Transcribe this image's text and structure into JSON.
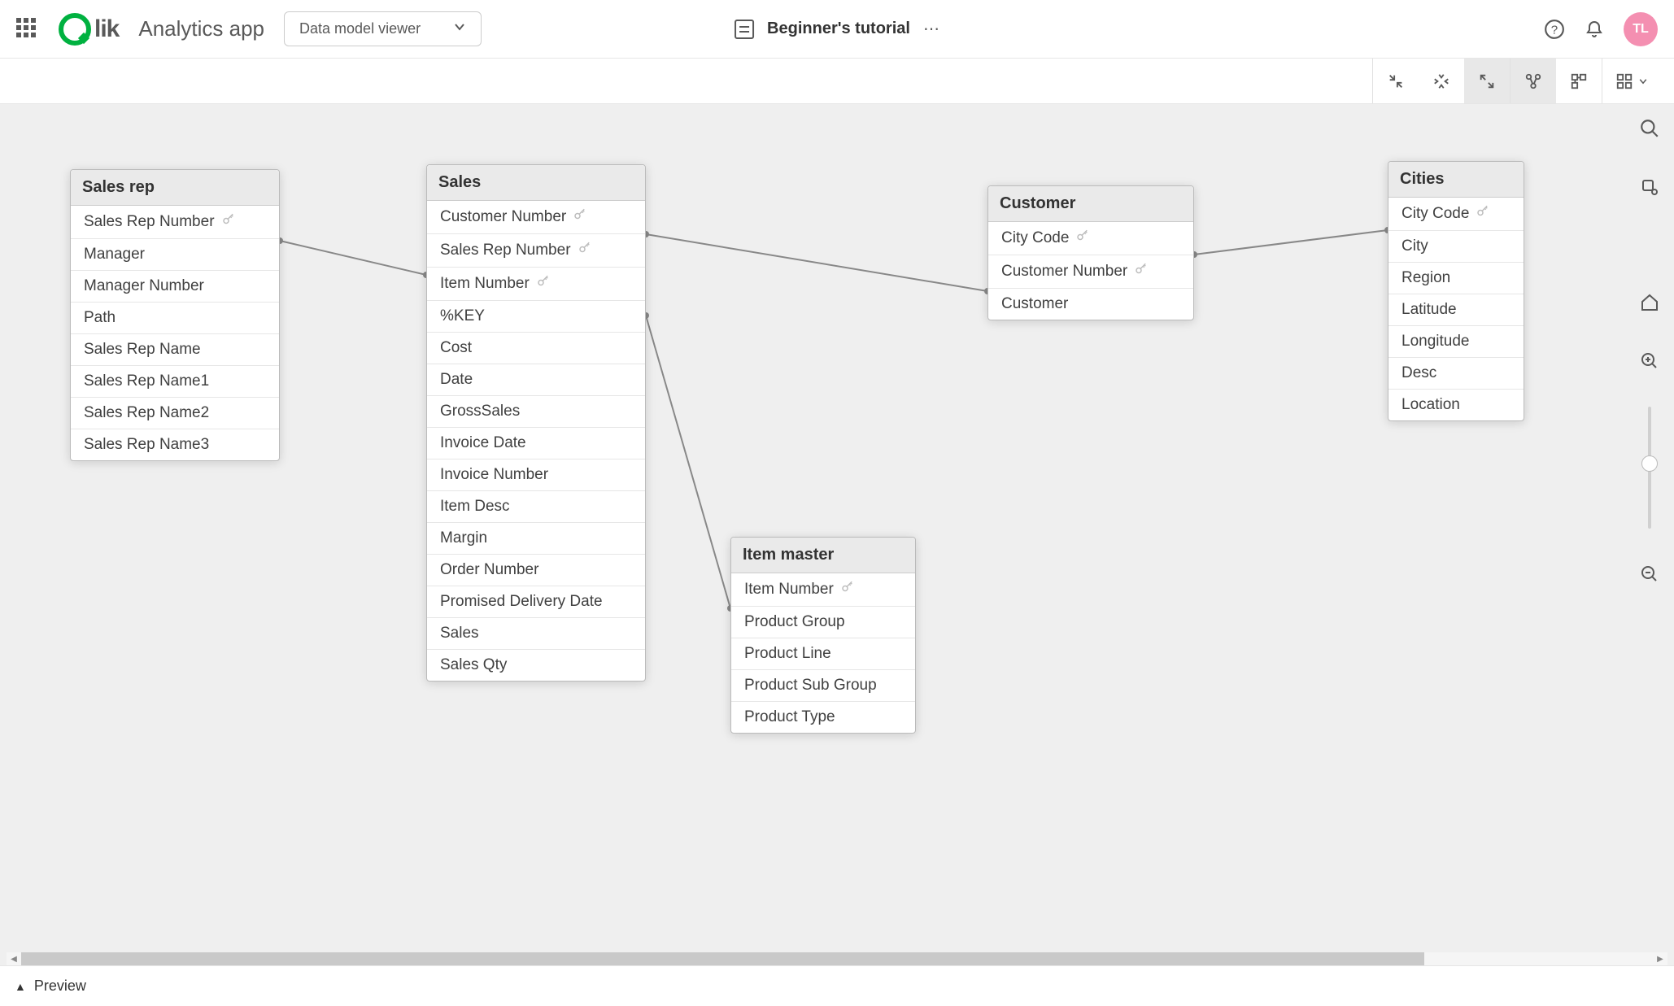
{
  "header": {
    "app_name": "Analytics app",
    "dropdown_label": "Data model viewer",
    "tutorial_name": "Beginner's tutorial",
    "avatar_initials": "TL"
  },
  "tables": {
    "sales_rep": {
      "title": "Sales rep",
      "fields": [
        "Sales Rep Number",
        "Manager",
        "Manager Number",
        "Path",
        "Sales Rep Name",
        "Sales Rep Name1",
        "Sales Rep Name2",
        "Sales Rep Name3"
      ],
      "key_fields": [
        "Sales Rep Number"
      ]
    },
    "sales": {
      "title": "Sales",
      "fields": [
        "Customer Number",
        "Sales Rep Number",
        "Item Number",
        "%KEY",
        "Cost",
        "Date",
        "GrossSales",
        "Invoice Date",
        "Invoice Number",
        "Item Desc",
        "Margin",
        "Order Number",
        "Promised Delivery Date",
        "Sales",
        "Sales Qty"
      ],
      "key_fields": [
        "Customer Number",
        "Sales Rep Number",
        "Item Number"
      ]
    },
    "item_master": {
      "title": "Item master",
      "fields": [
        "Item Number",
        "Product Group",
        "Product Line",
        "Product Sub Group",
        "Product Type"
      ],
      "key_fields": [
        "Item Number"
      ]
    },
    "customer": {
      "title": "Customer",
      "fields": [
        "City Code",
        "Customer Number",
        "Customer"
      ],
      "key_fields": [
        "City Code",
        "Customer Number"
      ]
    },
    "cities": {
      "title": "Cities",
      "fields": [
        "City Code",
        "City",
        "Region",
        "Latitude",
        "Longitude",
        "Desc",
        "Location"
      ],
      "key_fields": [
        "City Code"
      ]
    }
  },
  "footer": {
    "preview_label": "Preview"
  }
}
